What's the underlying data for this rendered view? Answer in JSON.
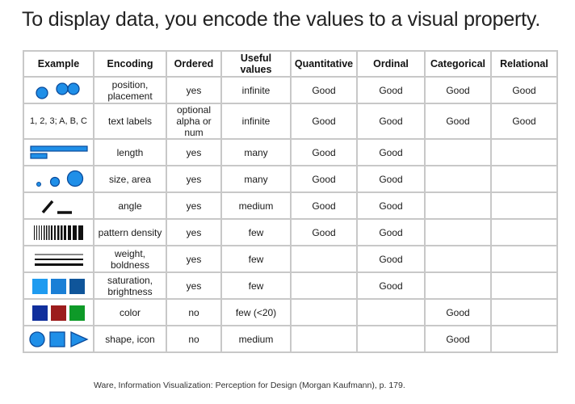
{
  "title": "To display data, you encode the values to a visual property.",
  "columns": [
    "Example",
    "Encoding",
    "Ordered",
    "Useful values",
    "Quantitative",
    "Ordinal",
    "Categorical",
    "Relational"
  ],
  "rows": [
    {
      "example": "position-circles-icon",
      "encoding": "position, placement",
      "ordered": "yes",
      "useful": "infinite",
      "quant": "Good",
      "ordinal": "Good",
      "categorical": "Good",
      "relational": "Good"
    },
    {
      "example_text": "1, 2, 3; A, B, C",
      "encoding": "text labels",
      "ordered": "optional alpha or num",
      "useful": "infinite",
      "quant": "Good",
      "ordinal": "Good",
      "categorical": "Good",
      "relational": "Good"
    },
    {
      "example": "length-bars-icon",
      "encoding": "length",
      "ordered": "yes",
      "useful": "many",
      "quant": "Good",
      "ordinal": "Good",
      "categorical": "",
      "relational": ""
    },
    {
      "example": "size-circles-icon",
      "encoding": "size, area",
      "ordered": "yes",
      "useful": "many",
      "quant": "Good",
      "ordinal": "Good",
      "categorical": "",
      "relational": ""
    },
    {
      "example": "angle-lines-icon",
      "encoding": "angle",
      "ordered": "yes",
      "useful": "medium",
      "quant": "Good",
      "ordinal": "Good",
      "categorical": "",
      "relational": ""
    },
    {
      "example": "barcode-density-icon",
      "encoding": "pattern density",
      "ordered": "yes",
      "useful": "few",
      "quant": "Good",
      "ordinal": "Good",
      "categorical": "",
      "relational": ""
    },
    {
      "example": "line-weight-icon",
      "encoding": "weight, boldness",
      "ordered": "yes",
      "useful": "few",
      "quant": "",
      "ordinal": "Good",
      "categorical": "",
      "relational": ""
    },
    {
      "example": "saturation-squares-icon",
      "encoding": "saturation, brightness",
      "ordered": "yes",
      "useful": "few",
      "quant": "",
      "ordinal": "Good",
      "categorical": "",
      "relational": ""
    },
    {
      "example": "color-squares-icon",
      "encoding": "color",
      "ordered": "no",
      "useful": "few (<20)",
      "quant": "",
      "ordinal": "",
      "categorical": "Good",
      "relational": ""
    },
    {
      "example": "shape-icons-icon",
      "encoding": "shape, icon",
      "ordered": "no",
      "useful": "medium",
      "quant": "",
      "ordinal": "",
      "categorical": "Good",
      "relational": ""
    }
  ],
  "colors": {
    "blue": "#1f8fe8",
    "blue_stroke": "#0a4a9a",
    "sat_light": "#1e9bf0",
    "sat_mid": "#1a7fd6",
    "sat_dark": "#0f559a",
    "color_blue": "#102f9c",
    "color_red": "#9c1c1c",
    "color_green": "#0e9a28"
  },
  "caption": "Ware, Information Visualization: Perception for Design (Morgan Kaufmann), p. 179."
}
